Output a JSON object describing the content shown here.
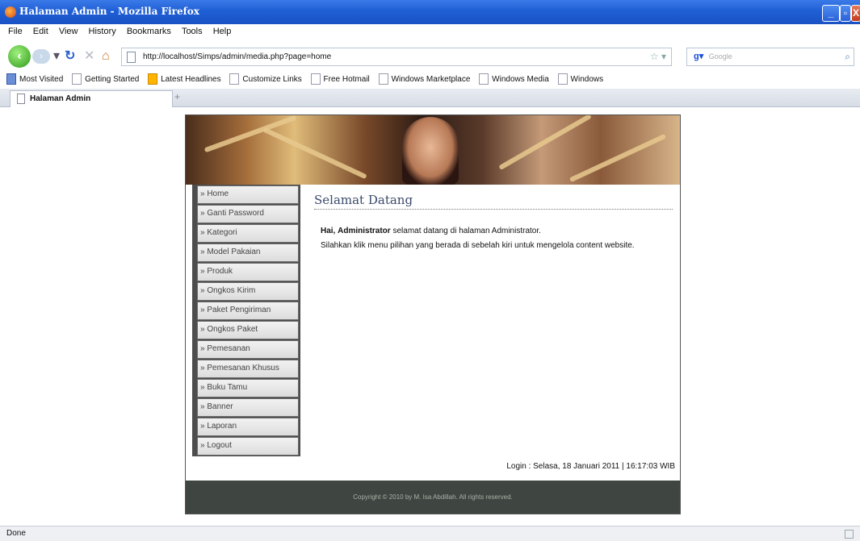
{
  "window": {
    "title": "Halaman Admin - Mozilla Firefox",
    "controls": [
      "_",
      "▫",
      "X"
    ]
  },
  "menubar": [
    "File",
    "Edit",
    "View",
    "History",
    "Bookmarks",
    "Tools",
    "Help"
  ],
  "nav": {
    "url": "http://localhost/Simps/admin/media.php?page=home",
    "search_placeholder": "Google"
  },
  "bookmarks": [
    "Most Visited",
    "Getting Started",
    "Latest Headlines",
    "Customize Links",
    "Free Hotmail",
    "Windows Marketplace",
    "Windows Media",
    "Windows"
  ],
  "tabs": [
    {
      "label": "Halaman Admin"
    }
  ],
  "page": {
    "menu": [
      "» Home",
      "» Ganti Password",
      "» Kategori",
      "» Model Pakaian",
      "» Produk",
      "» Ongkos Kirim",
      "» Paket Pengiriman",
      "» Ongkos Paket",
      "» Pemesanan",
      "» Pemesanan Khusus",
      "» Buku Tamu",
      "» Banner",
      "» Laporan",
      "» Logout"
    ],
    "heading": "Selamat Datang",
    "welcome_prefix": "Hai,",
    "welcome_user": "Administrator",
    "welcome_suffix": "selamat datang di halaman Administrator.",
    "instruction": "Silahkan klik menu pilihan yang berada di sebelah kiri untuk mengelola content website.",
    "login_info": "Login : Selasa, 18 Januari 2011 | 16:17:03 WIB",
    "footer": "Copyright © 2010 by M. Isa Abdillah. All rights reserved."
  },
  "status": "Done",
  "icons": {
    "back": "back-arrow-icon",
    "reload": "reload-icon",
    "stop": "stop-icon",
    "home": "home-icon"
  }
}
